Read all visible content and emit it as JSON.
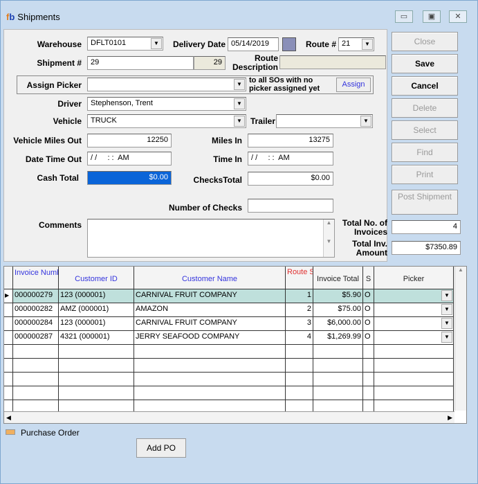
{
  "window": {
    "title": "Shipments",
    "logo_f": "f",
    "logo_b": "b"
  },
  "form": {
    "warehouse_label": "Warehouse",
    "warehouse": "DFLT0101",
    "delivery_date_label": "Delivery Date",
    "delivery_date": "05/14/2019",
    "route_label": "Route #",
    "route": "21",
    "shipment_label": "Shipment #",
    "shipment": "29",
    "shipment_id": "29",
    "route_desc_label": "Route Description",
    "route_desc": "",
    "assign_picker_label": "Assign Picker",
    "assign_picker": "",
    "assign_note": "to all SOs with no picker assigned yet",
    "assign_button": "Assign",
    "driver_label": "Driver",
    "driver": "Stephenson, Trent",
    "vehicle_label": "Vehicle",
    "vehicle": "TRUCK",
    "trailer_label": "Trailer",
    "trailer": "",
    "miles_out_label": "Vehicle Miles Out",
    "miles_out": "12250",
    "miles_in_label": "Miles In",
    "miles_in": "13275",
    "dt_out_label": "Date Time Out",
    "dt_out": "/ /     : :  AM",
    "time_in_label": "Time In",
    "time_in": "/ /     : :  AM",
    "cash_label": "Cash Total",
    "cash": "$0.00",
    "checks_label": "ChecksTotal",
    "checks": "$0.00",
    "num_checks_label": "Number of Checks",
    "num_checks": "",
    "comments_label": "Comments",
    "comments": "",
    "total_invoices_label": "Total No. of Invoices",
    "total_invoices": "4",
    "total_amount_label": "Total Inv. Amount",
    "total_amount": "$7350.89"
  },
  "buttons": {
    "close": "Close",
    "save": "Save",
    "cancel": "Cancel",
    "delete": "Delete",
    "select": "Select",
    "find": "Find",
    "print": "Print",
    "post": "Post Shipment"
  },
  "grid": {
    "headers": [
      "Invoice Number",
      "Customer ID",
      "Customer Name",
      "Route Stop #",
      "Invoice Total",
      "S",
      "Picker"
    ],
    "rows": [
      [
        "000000279",
        "123 (000001)",
        "CARNIVAL FRUIT COMPANY",
        "1",
        "$5.90",
        "O",
        ""
      ],
      [
        "000000282",
        "AMZ (000001)",
        "AMAZON",
        "2",
        "$75.00",
        "O",
        ""
      ],
      [
        "000000284",
        "123 (000001)",
        "CARNIVAL FRUIT COMPANY",
        "3",
        "$6,000.00",
        "O",
        ""
      ],
      [
        "000000287",
        "4321 (000001)",
        "JERRY SEAFOOD COMPANY",
        "4",
        "$1,269.99",
        "O",
        ""
      ]
    ]
  },
  "legend": {
    "purchase_order": "Purchase Order"
  },
  "add_po": "Add PO",
  "colors": {
    "selected_row": "#bfe0dc",
    "cash_highlight": "#0a64d8",
    "route_header": "#e03030",
    "header_blue": "#3333dd"
  }
}
